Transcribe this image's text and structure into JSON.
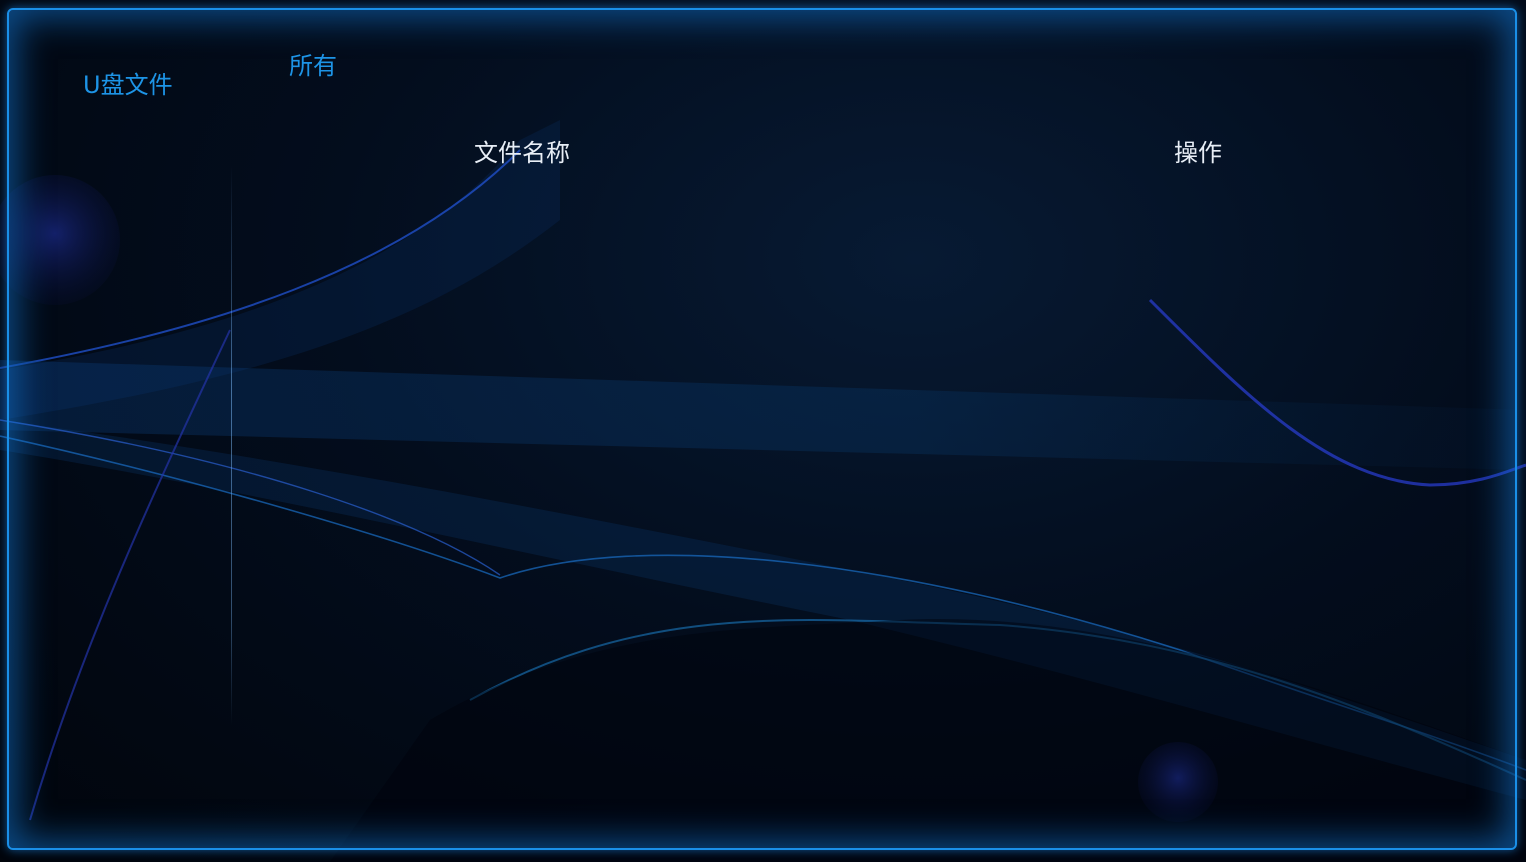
{
  "sidebar": {
    "items": [
      {
        "label": "U盘文件"
      }
    ]
  },
  "filter": {
    "selected_label": "所有"
  },
  "file_table": {
    "columns": [
      "文件名称",
      "操作"
    ],
    "rows": []
  },
  "theme": {
    "accent": "#1d94e6",
    "frame_border": "#1a8fe8",
    "header_text": "#e8eef6",
    "background": "#01060f"
  }
}
